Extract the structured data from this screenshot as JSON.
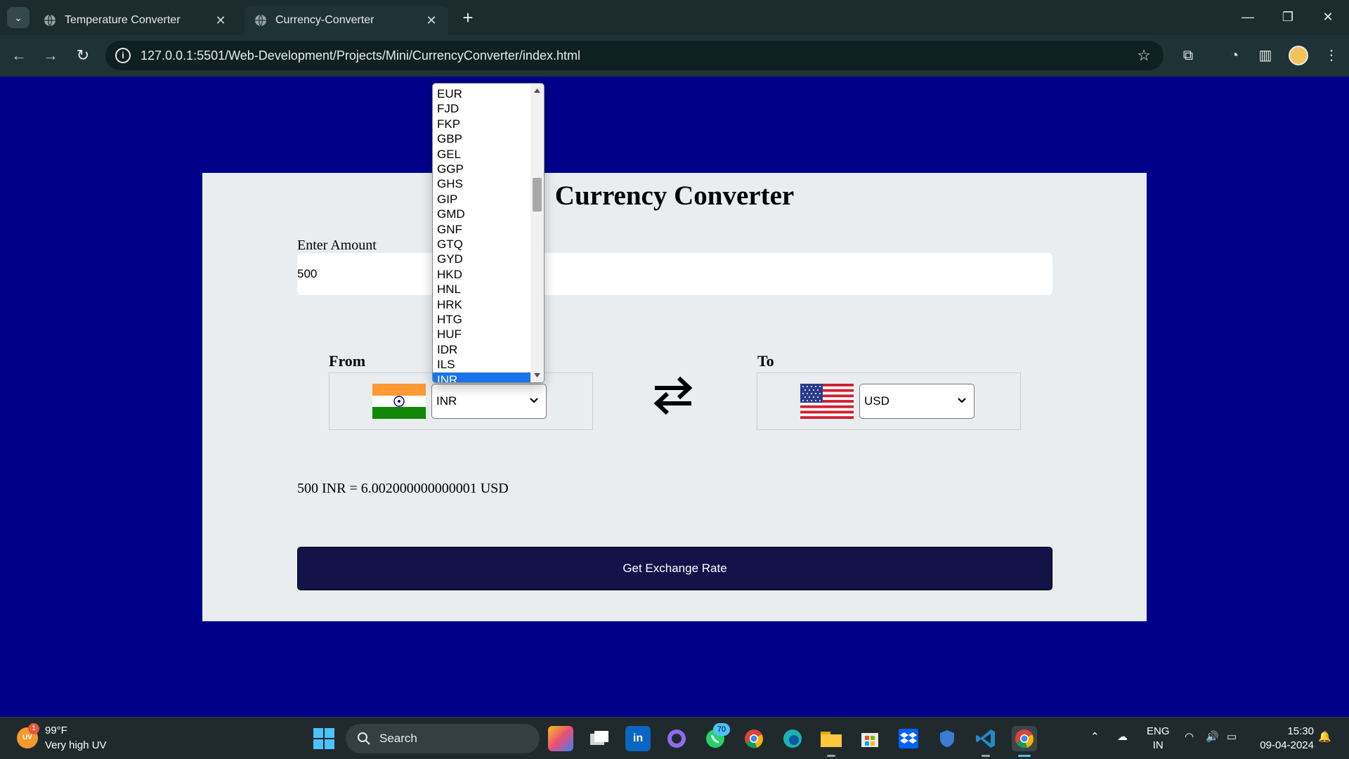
{
  "browser": {
    "tabs": [
      {
        "title": "Temperature Converter",
        "active": false
      },
      {
        "title": "Currency-Converter",
        "active": true
      }
    ],
    "url": "127.0.0.1:5501/Web-Development/Projects/Mini/CurrencyConverter/index.html",
    "icons": [
      "tab-search-icon",
      "globe-icon",
      "close-icon",
      "plus-icon",
      "minimize-icon",
      "restore-icon",
      "close-window-icon",
      "back-icon",
      "forward-icon",
      "reload-icon",
      "info-icon",
      "star-icon",
      "extensions-icon",
      "performance-icon",
      "side-panel-icon",
      "profile-avatar",
      "menu-icon"
    ]
  },
  "app": {
    "title": "Currency Converter",
    "amount_label": "Enter Amount",
    "amount_value": "500",
    "from_label": "From",
    "to_label": "To",
    "from_currency": "INR",
    "to_currency": "USD",
    "result": "500 INR = 6.002000000000001 USD",
    "button_label": "Get Exchange Rate"
  },
  "dropdown": {
    "options": [
      "EUR",
      "FJD",
      "FKP",
      "GBP",
      "GEL",
      "GGP",
      "GHS",
      "GIP",
      "GMD",
      "GNF",
      "GTQ",
      "GYD",
      "HKD",
      "HNL",
      "HRK",
      "HTG",
      "HUF",
      "IDR",
      "ILS",
      "INR"
    ],
    "selected": "INR"
  },
  "taskbar": {
    "weather_temp": "99°F",
    "weather_desc": "Very high UV",
    "weather_icon_text": "UV",
    "weather_badge": "1",
    "search_label": "Search",
    "whatsapp_badge": "70",
    "lang_line1": "ENG",
    "lang_line2": "IN",
    "time": "15:30",
    "date": "09-04-2024"
  },
  "colors": {
    "page_background": "#00008b",
    "card_background": "#e9edef",
    "button_background": "#13134a",
    "dropdown_selected": "#1a73e8"
  }
}
